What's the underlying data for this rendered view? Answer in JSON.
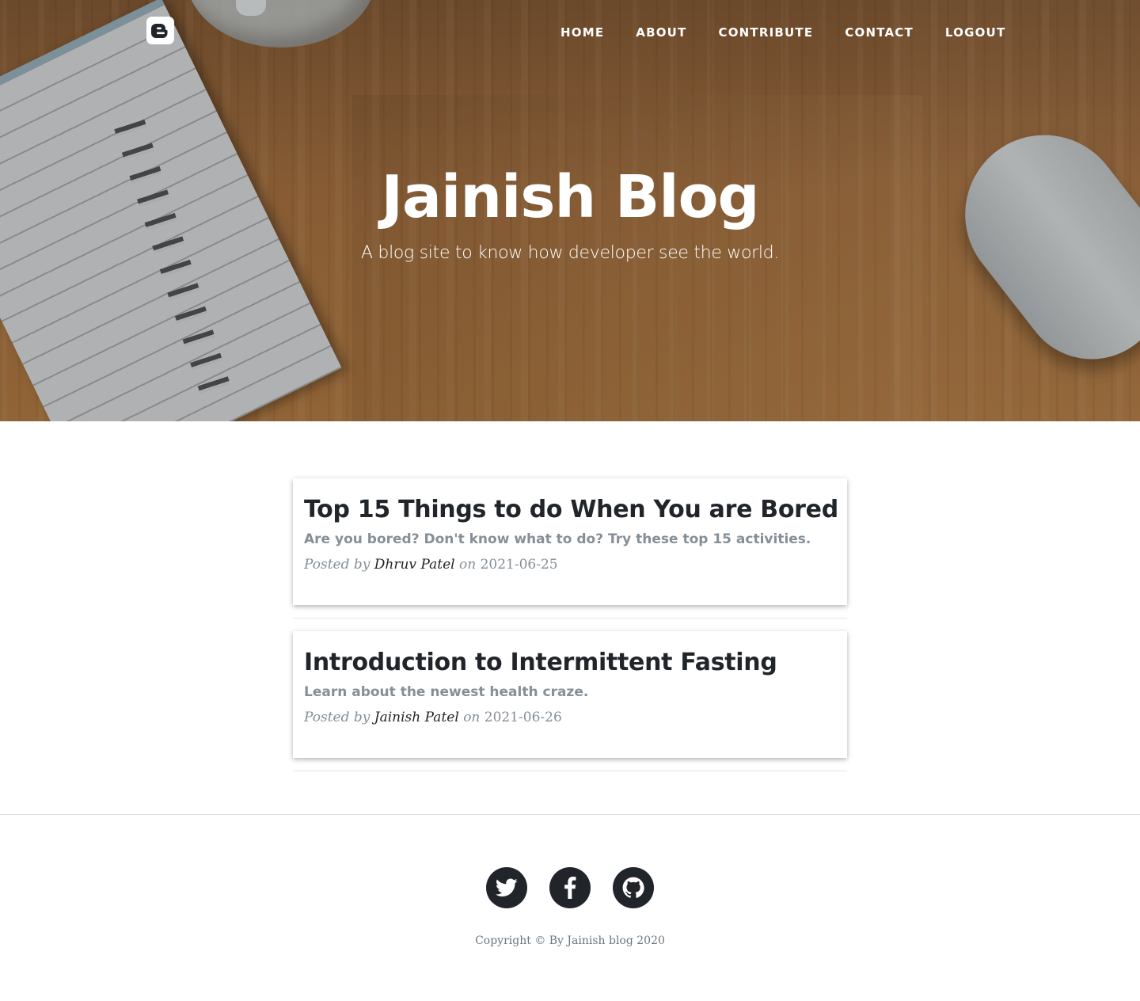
{
  "nav": {
    "items": [
      {
        "label": "HOME"
      },
      {
        "label": "ABOUT"
      },
      {
        "label": "CONTRIBUTE"
      },
      {
        "label": "CONTACT"
      },
      {
        "label": "LOGOUT"
      }
    ]
  },
  "hero": {
    "title": "Jainish Blog",
    "subtitle": "A blog site to know how developer see the world."
  },
  "posts": [
    {
      "title": "Top 15 Things to do When You are Bored",
      "subtitle": "Are you bored? Don't know what to do? Try these top 15 activities.",
      "posted_by": "Posted by",
      "author": "Dhruv Patel",
      "on": "on",
      "date": "2021-06-25"
    },
    {
      "title": "Introduction to Intermittent Fasting",
      "subtitle": "Learn about the newest health craze.",
      "posted_by": "Posted by",
      "author": "Jainish Patel",
      "on": "on",
      "date": "2021-06-26"
    }
  ],
  "footer": {
    "social": [
      {
        "icon": "twitter-icon"
      },
      {
        "icon": "facebook-icon"
      },
      {
        "icon": "github-icon"
      }
    ],
    "copyright": "Copyright © By Jainish blog 2020"
  },
  "colors": {
    "heading": "#212529",
    "muted": "#868e96",
    "social_bg": "#212529"
  }
}
